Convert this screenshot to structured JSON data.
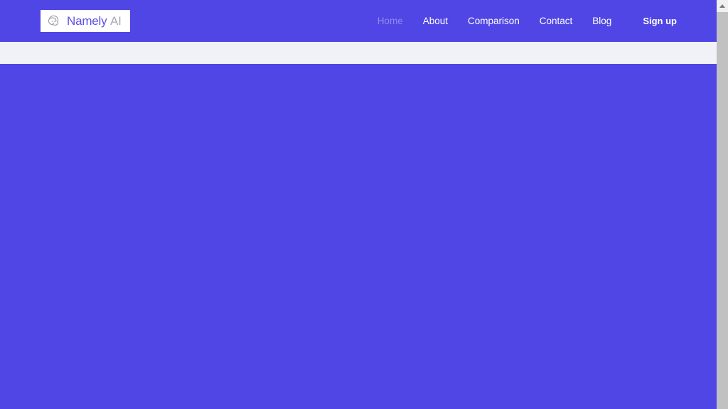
{
  "brand": {
    "icon": "face-icon",
    "name_main": "Namely",
    "name_sub": "AI"
  },
  "nav": {
    "items": [
      {
        "label": "Home",
        "state": "active"
      },
      {
        "label": "About",
        "state": "default"
      },
      {
        "label": "Comparison",
        "state": "default"
      },
      {
        "label": "Contact",
        "state": "default"
      },
      {
        "label": "Blog",
        "state": "default"
      }
    ],
    "cta": {
      "label": "Sign up"
    }
  },
  "colors": {
    "brand_purple": "#5046e5",
    "logo_text": "#5b50e8",
    "logo_text_muted": "#a9a9b4",
    "band": "#f1f2f8",
    "scrollbar_track": "#f0f0f0",
    "scrollbar_thumb": "#c1c1c1"
  },
  "scrollbar": {
    "up_arrow": "scroll-up-arrow-icon"
  }
}
